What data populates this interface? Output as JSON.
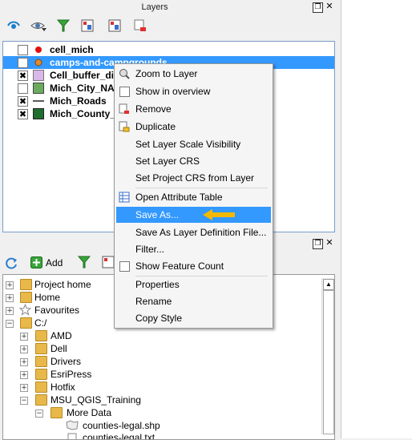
{
  "layers_panel": {
    "title": "Layers",
    "float_glyph": "❐",
    "close_glyph": "✕",
    "layers": [
      {
        "name": "cell_mich",
        "checked": false,
        "symbol": "red-dot"
      },
      {
        "name": "camps-and-campgrounds",
        "checked": true,
        "symbol": "orange-dot",
        "selected": true
      },
      {
        "name": "Cell_buffer_di",
        "checked": true,
        "symbol": "lavender-fill"
      },
      {
        "name": "Mich_City_NAI",
        "checked": false,
        "symbol": "green-fill"
      },
      {
        "name": "Mich_Roads",
        "checked": true,
        "symbol": "line"
      },
      {
        "name": "Mich_County_",
        "checked": true,
        "symbol": "darkgreen-fill"
      }
    ],
    "check_glyph": "✖"
  },
  "context_menu": {
    "items": [
      {
        "label": "Zoom to Layer",
        "icon": "zoom-icon"
      },
      {
        "label": "Show in overview",
        "icon": "checkbox-icon"
      },
      {
        "label": "Remove",
        "icon": "remove-layer-icon"
      },
      {
        "label": "Duplicate",
        "icon": "duplicate-layer-icon"
      },
      {
        "label": "Set Layer Scale Visibility"
      },
      {
        "label": "Set Layer CRS"
      },
      {
        "label": "Set Project CRS from Layer"
      },
      {
        "label": "Open Attribute Table",
        "icon": "table-icon"
      },
      {
        "label": "Save As...",
        "highlighted": true
      },
      {
        "label": "Save As Layer Definition File..."
      },
      {
        "label": "Filter..."
      },
      {
        "label": "Show Feature Count",
        "icon": "checkbox-icon"
      },
      {
        "label": "Properties"
      },
      {
        "label": "Rename"
      },
      {
        "label": "Copy Style"
      }
    ],
    "arrow_color": "#f5b800",
    "highlight_color": "#3399ff"
  },
  "browser_panel": {
    "add_label": "Add",
    "tree": [
      {
        "label": "Project home",
        "depth": 0,
        "expander": "+"
      },
      {
        "label": "Home",
        "depth": 0,
        "expander": "+"
      },
      {
        "label": "Favourites",
        "depth": 0,
        "expander": "+",
        "icon": "star"
      },
      {
        "label": "C:/",
        "depth": 0,
        "expander": "−"
      },
      {
        "label": "AMD",
        "depth": 1,
        "expander": "+"
      },
      {
        "label": "Dell",
        "depth": 1,
        "expander": "+"
      },
      {
        "label": "Drivers",
        "depth": 1,
        "expander": "+"
      },
      {
        "label": "EsriPress",
        "depth": 1,
        "expander": "+"
      },
      {
        "label": "Hotfix",
        "depth": 1,
        "expander": "+"
      },
      {
        "label": "MSU_QGIS_Training",
        "depth": 1,
        "expander": "−"
      },
      {
        "label": "More Data",
        "depth": 2,
        "expander": "−"
      },
      {
        "label": "counties-legal.shp",
        "depth": 3,
        "icon": "shape"
      },
      {
        "label": "counties-legal.txt",
        "depth": 3,
        "icon": "file"
      }
    ],
    "scroll_up": "▲"
  }
}
